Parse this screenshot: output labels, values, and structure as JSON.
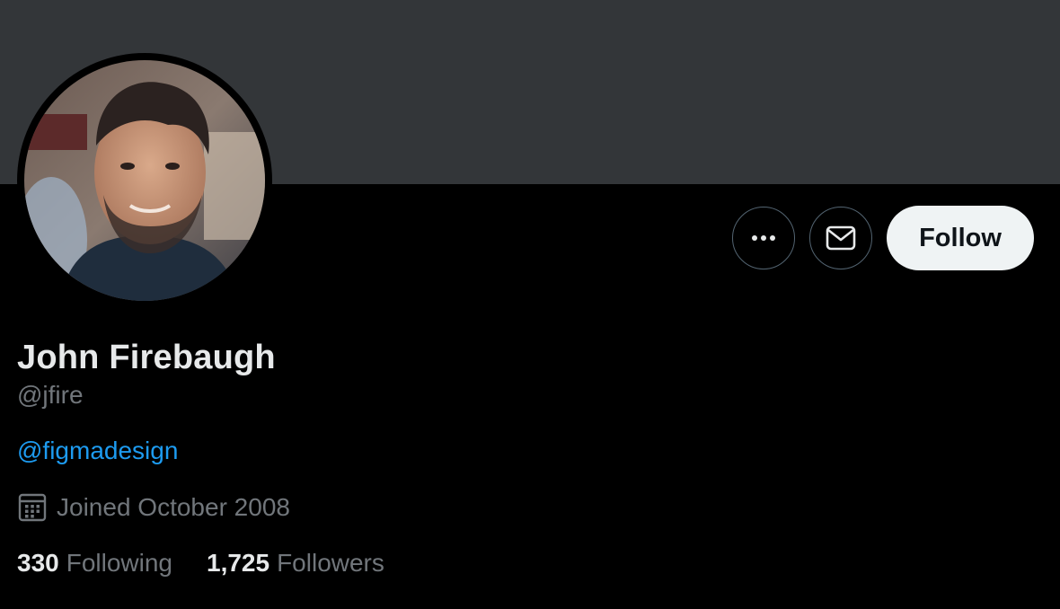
{
  "profile": {
    "name": "John Firebaugh",
    "handle": "@jfire",
    "bio_link": "@figmadesign",
    "joined": "Joined October 2008",
    "following_count": "330",
    "following_label": "Following",
    "followers_count": "1,725",
    "followers_label": "Followers"
  },
  "actions": {
    "more_icon": "more-horizontal-icon",
    "message_icon": "envelope-icon",
    "follow_label": "Follow"
  },
  "colors": {
    "background": "#000000",
    "banner": "#333639",
    "primary_text": "#e7e9ea",
    "secondary_text": "#71767b",
    "link": "#1d9bf0",
    "follow_button_bg": "#eff3f4"
  }
}
